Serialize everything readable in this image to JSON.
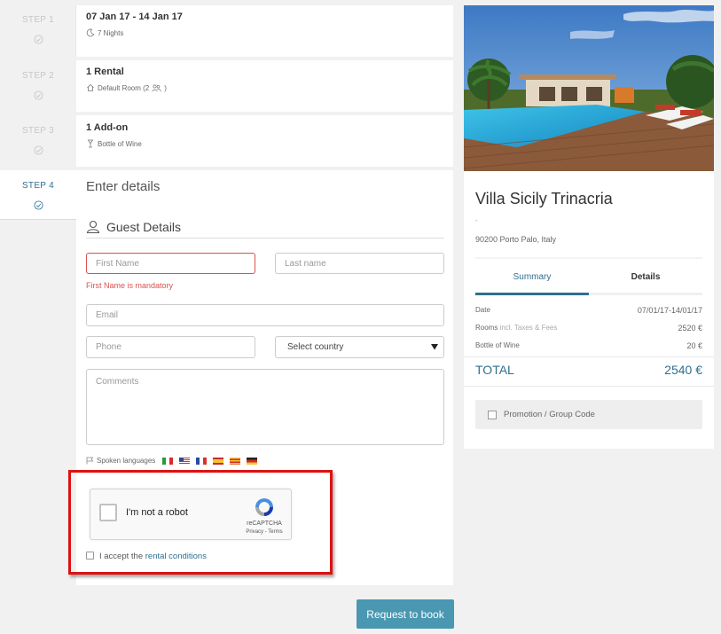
{
  "steps": [
    {
      "label": "STEP 1",
      "title": "07 Jan 17 - 14 Jan 17",
      "subtitle": "7 Nights"
    },
    {
      "label": "STEP 2",
      "title": "1 Rental",
      "subtitle": "Default Room (2"
    },
    {
      "label": "STEP 3",
      "title": "1 Add-on",
      "subtitle": "Bottle of Wine"
    },
    {
      "label": "STEP 4",
      "title": "Enter details"
    }
  ],
  "room_guest_suffix": ")",
  "form": {
    "section_title": "Guest Details",
    "first_name_placeholder": "First Name",
    "first_name_error": "First Name is mandatory",
    "last_name_placeholder": "Last name",
    "email_placeholder": "Email",
    "phone_placeholder": "Phone",
    "country_select": "Select country",
    "comments_placeholder": "Comments",
    "spoken_languages_label": "Spoken languages",
    "languages": [
      "Italian",
      "English",
      "French",
      "Spanish",
      "Catalan",
      "German"
    ]
  },
  "recaptcha": {
    "label": "I'm not a robot",
    "brand": "reCAPTCHA",
    "links": "Privacy - Terms"
  },
  "terms": {
    "prefix": "I accept the",
    "link": "rental conditions"
  },
  "submit_label": "Request to book",
  "property": {
    "name": "Villa Sicily Trinacria",
    "dash": "-",
    "address": "90200 Porto Palo, Italy"
  },
  "tabs": [
    {
      "label": "Summary",
      "active": true
    },
    {
      "label": "Details",
      "active": false
    }
  ],
  "summary": {
    "date_label": "Date",
    "date_value": "07/01/17-14/01/17",
    "rooms_label": "Rooms",
    "rooms_note": "incl. Taxes & Fees",
    "rooms_value": "2520 €",
    "wine_label": "Bottle of Wine",
    "wine_value": "20 €",
    "total_label": "TOTAL",
    "total_value": "2540 €"
  },
  "promo_label": "Promotion / Group Code",
  "colors": {
    "accent": "#2f6f8f",
    "error": "#d9534f",
    "highlight": "#dd1111",
    "button": "#4a97b2"
  }
}
